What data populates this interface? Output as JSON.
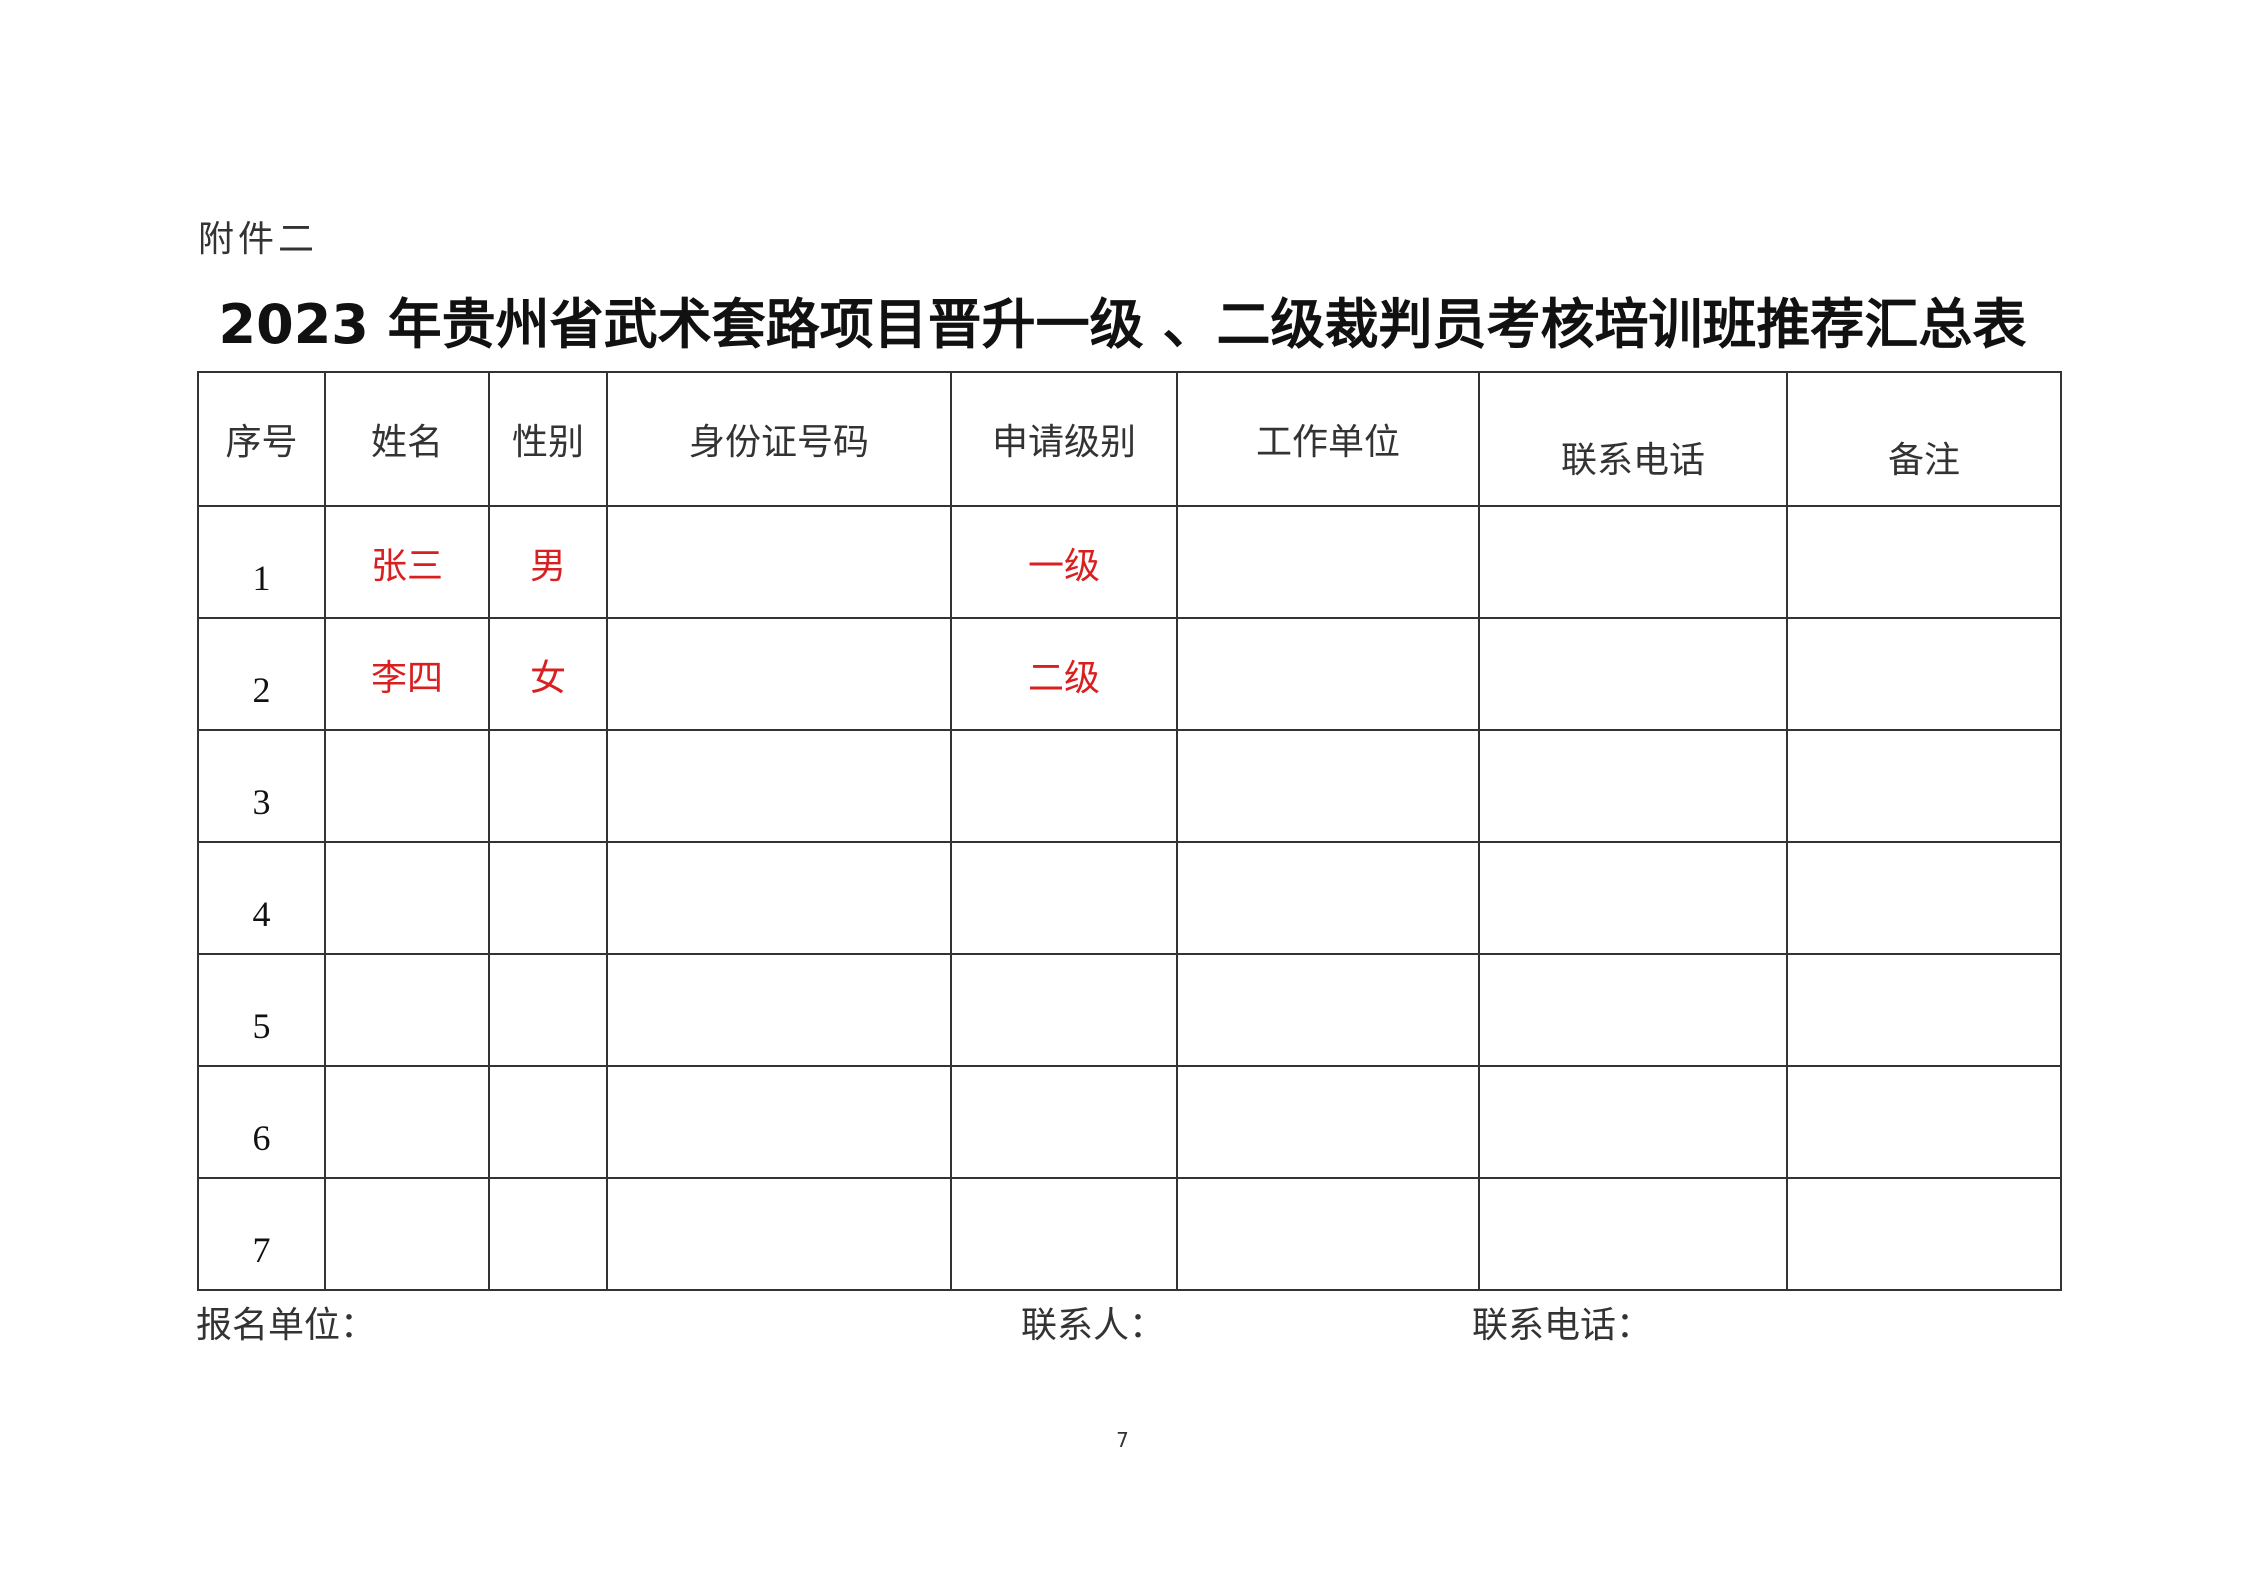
{
  "attachment_label": "附件二",
  "title": "2023 年贵州省武术套路项目晋升一级 、二级裁判员考核培训班推荐汇总表",
  "table": {
    "headers": [
      "序号",
      "姓名",
      "性别",
      "身份证号码",
      "申请级别",
      "工作单位",
      "联系电话",
      "备注"
    ],
    "rows": [
      {
        "seq": "1",
        "name": "张三",
        "gender": "男",
        "id": "",
        "level": "一级",
        "unit": "",
        "phone": "",
        "note": ""
      },
      {
        "seq": "2",
        "name": "李四",
        "gender": "女",
        "id": "",
        "level": "二级",
        "unit": "",
        "phone": "",
        "note": ""
      },
      {
        "seq": "3",
        "name": "",
        "gender": "",
        "id": "",
        "level": "",
        "unit": "",
        "phone": "",
        "note": ""
      },
      {
        "seq": "4",
        "name": "",
        "gender": "",
        "id": "",
        "level": "",
        "unit": "",
        "phone": "",
        "note": ""
      },
      {
        "seq": "5",
        "name": "",
        "gender": "",
        "id": "",
        "level": "",
        "unit": "",
        "phone": "",
        "note": ""
      },
      {
        "seq": "6",
        "name": "",
        "gender": "",
        "id": "",
        "level": "",
        "unit": "",
        "phone": "",
        "note": ""
      },
      {
        "seq": "7",
        "name": "",
        "gender": "",
        "id": "",
        "level": "",
        "unit": "",
        "phone": "",
        "note": ""
      }
    ]
  },
  "footer": {
    "unit_label": "报名单位：",
    "contact_label": "联系人：",
    "phone_label": "联系电话："
  },
  "page_number": "7",
  "colors": {
    "example_text": "#d92020",
    "border": "#333333"
  }
}
